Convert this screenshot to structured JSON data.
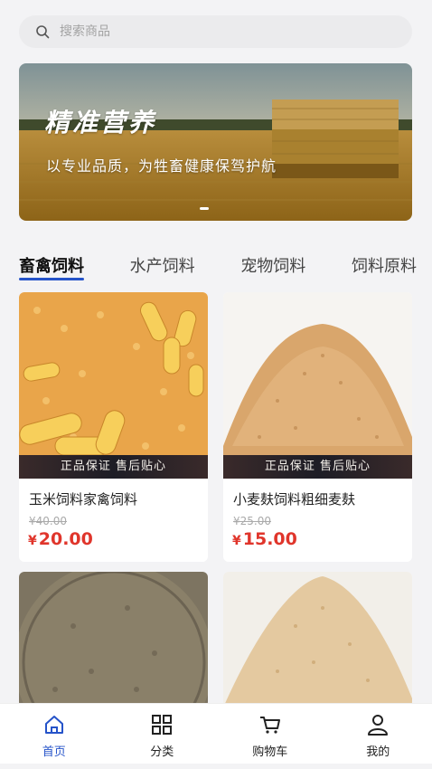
{
  "search": {
    "placeholder": "搜索商品"
  },
  "banner": {
    "title": "精准营养",
    "subtitle": "以专业品质，为牲畜健康保驾护航"
  },
  "categories": [
    {
      "label": "畜禽饲料",
      "active": true
    },
    {
      "label": "水产饲料",
      "active": false
    },
    {
      "label": "宠物饲料",
      "active": false
    },
    {
      "label": "饲料原料",
      "active": false
    }
  ],
  "products": [
    {
      "name": "玉米饲料家禽饲料",
      "old_price": "¥40.00",
      "currency": "¥",
      "price": "20.00",
      "badge": "正品保证 售后贴心",
      "image": "corn-kernels"
    },
    {
      "name": "小麦麸饲料粗细麦麸",
      "old_price": "¥25.00",
      "currency": "¥",
      "price": "15.00",
      "badge": "正品保证 售后贴心",
      "image": "wheat-bran"
    },
    {
      "image": "gray-powder"
    },
    {
      "image": "light-flakes"
    }
  ],
  "tabbar": [
    {
      "label": "首页",
      "icon": "home-icon",
      "active": true
    },
    {
      "label": "分类",
      "icon": "grid-icon",
      "active": false
    },
    {
      "label": "购物车",
      "icon": "cart-icon",
      "active": false
    },
    {
      "label": "我的",
      "icon": "user-icon",
      "active": false
    }
  ],
  "colors": {
    "accent": "#2553c9",
    "price": "#e0352b"
  }
}
